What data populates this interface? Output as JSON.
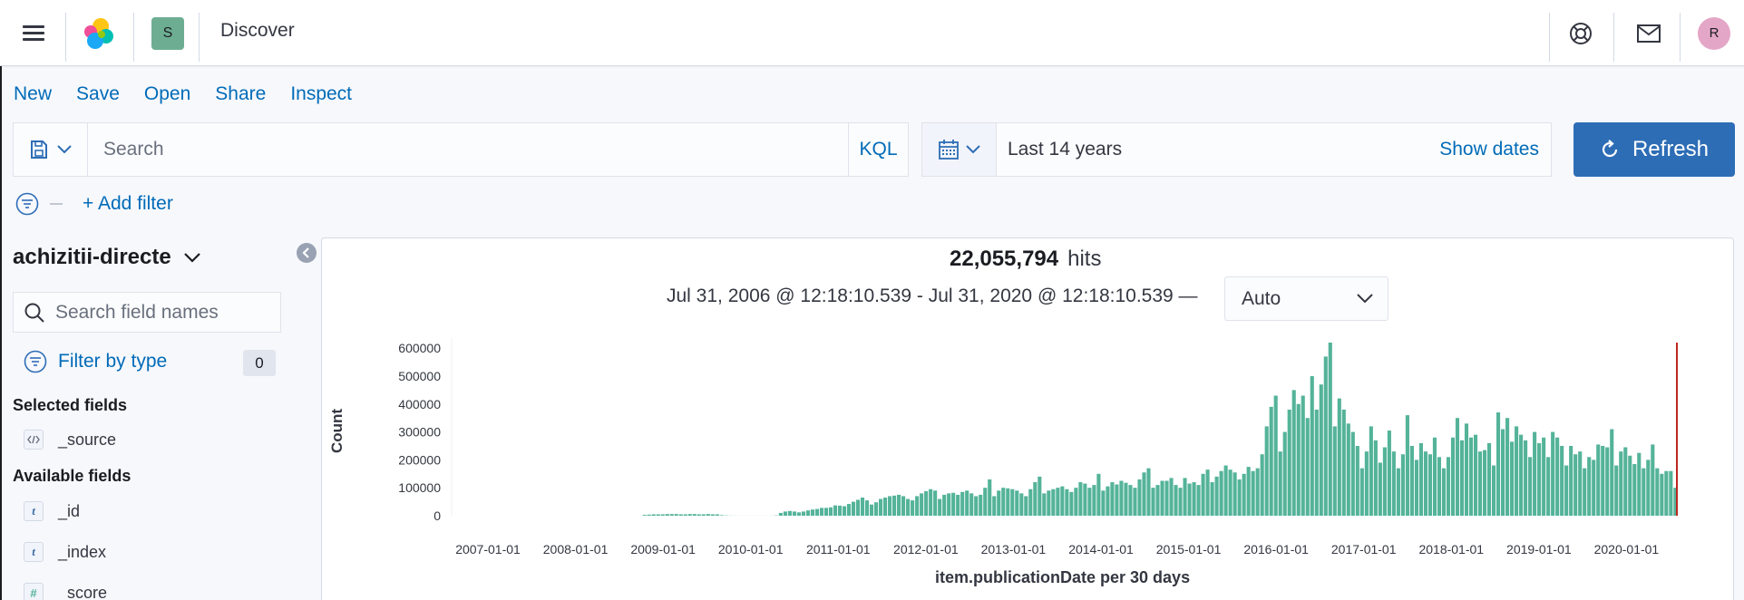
{
  "header": {
    "title": "Discover",
    "space_initial": "S",
    "avatar_initial": "R"
  },
  "topnav": [
    "New",
    "Save",
    "Open",
    "Share",
    "Inspect"
  ],
  "query": {
    "placeholder": "Search",
    "language": "KQL"
  },
  "date": {
    "range": "Last 14 years",
    "show_dates": "Show dates",
    "refresh": "Refresh"
  },
  "filters": {
    "add_label": "+ Add filter"
  },
  "sidebar": {
    "index_pattern": "achizitii-directe",
    "field_search_placeholder": "Search field names",
    "filter_by_type": "Filter by type",
    "filter_count": "0",
    "selected_heading": "Selected fields",
    "selected_fields": [
      {
        "type": "source",
        "name": "_source"
      }
    ],
    "available_heading": "Available fields",
    "available_fields": [
      {
        "type": "t",
        "name": "_id"
      },
      {
        "type": "t",
        "name": "_index"
      },
      {
        "type": "#",
        "name": "_score"
      }
    ]
  },
  "results": {
    "hits": "22,055,794",
    "hits_label": "hits",
    "range_text": "Jul 31, 2006 @ 12:18:10.539 - Jul 31, 2020 @ 12:18:10.539 —",
    "interval": "Auto"
  },
  "colors": {
    "bar": "#54b399",
    "now_marker": "#bd271e",
    "accent": "#006bb8",
    "refresh_button": "#2d6db6"
  },
  "chart_data": {
    "type": "bar",
    "ylabel": "Count",
    "xlabel": "item.publicationDate per 30 days",
    "ylim": [
      0,
      620000
    ],
    "yticks": [
      0,
      100000,
      200000,
      300000,
      400000,
      500000,
      600000
    ],
    "xtick_labels": [
      "2007-01-01",
      "2008-01-01",
      "2009-01-01",
      "2010-01-01",
      "2011-01-01",
      "2012-01-01",
      "2013-01-01",
      "2014-01-01",
      "2015-01-01",
      "2016-01-01",
      "2017-01-01",
      "2018-01-01",
      "2019-01-01",
      "2020-01-01"
    ],
    "values": [
      0,
      0,
      0,
      0,
      0,
      0,
      0,
      0,
      0,
      0,
      0,
      0,
      0,
      0,
      0,
      0,
      0,
      0,
      0,
      0,
      0,
      0,
      0,
      0,
      0,
      0,
      0,
      0,
      0,
      0,
      0,
      0,
      0,
      0,
      0,
      0,
      0,
      0,
      0,
      0,
      0,
      0,
      3000,
      4000,
      5000,
      5000,
      5000,
      6000,
      6000,
      6000,
      5000,
      5000,
      6000,
      6000,
      5000,
      5000,
      6000,
      5000,
      5000,
      2000,
      1000,
      500,
      300,
      200,
      200,
      200,
      200,
      200,
      200,
      200,
      300,
      1000,
      10000,
      15000,
      17000,
      15000,
      12000,
      15000,
      19000,
      22000,
      24000,
      28000,
      28000,
      30000,
      37000,
      36000,
      34000,
      42000,
      50000,
      57000,
      65000,
      55000,
      40000,
      48000,
      60000,
      65000,
      70000,
      72000,
      75000,
      70000,
      60000,
      55000,
      70000,
      80000,
      88000,
      95000,
      90000,
      60000,
      75000,
      80000,
      82000,
      75000,
      85000,
      90000,
      80000,
      70000,
      75000,
      100000,
      130000,
      70000,
      90000,
      100000,
      98000,
      95000,
      90000,
      80000,
      70000,
      95000,
      120000,
      140000,
      80000,
      90000,
      95000,
      100000,
      105000,
      95000,
      85000,
      100000,
      120000,
      115000,
      100000,
      110000,
      150000,
      90000,
      105000,
      120000,
      112000,
      125000,
      118000,
      110000,
      100000,
      130000,
      155000,
      170000,
      100000,
      110000,
      125000,
      125000,
      135000,
      110000,
      100000,
      135000,
      115000,
      120000,
      110000,
      150000,
      165000,
      120000,
      140000,
      160000,
      180000,
      165000,
      155000,
      130000,
      150000,
      175000,
      160000,
      170000,
      220000,
      320000,
      390000,
      430000,
      230000,
      300000,
      380000,
      450000,
      400000,
      430000,
      350000,
      500000,
      380000,
      470000,
      570000,
      620000,
      320000,
      420000,
      380000,
      330000,
      300000,
      250000,
      170000,
      230000,
      320000,
      270000,
      190000,
      245000,
      305000,
      230000,
      170000,
      220000,
      360000,
      250000,
      200000,
      260000,
      230000,
      220000,
      280000,
      210000,
      170000,
      210000,
      280000,
      350000,
      270000,
      330000,
      280000,
      290000,
      230000,
      235000,
      260000,
      180000,
      370000,
      310000,
      350000,
      265000,
      320000,
      290000,
      270000,
      210000,
      300000,
      260000,
      280000,
      210000,
      300000,
      280000,
      250000,
      180000,
      250000,
      220000,
      230000,
      170000,
      210000,
      200000,
      255000,
      250000,
      245000,
      310000,
      180000,
      230000,
      245000,
      215000,
      185000,
      225000,
      170000,
      200000,
      255000,
      170000,
      150000,
      160000,
      160000,
      100000
    ]
  }
}
